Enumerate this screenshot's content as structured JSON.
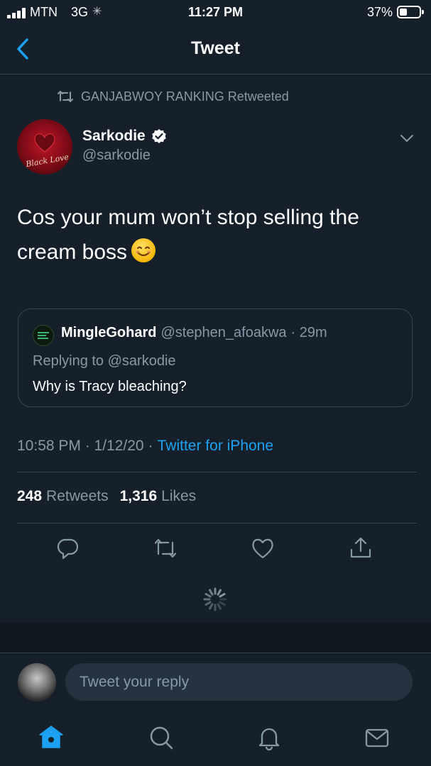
{
  "status_bar": {
    "carrier": "MTN",
    "network": "3G",
    "time": "11:27 PM",
    "battery_percent": "37%",
    "battery_level": 0.37
  },
  "header": {
    "title": "Tweet",
    "back_icon": "chevron-left-icon"
  },
  "retweet_context": {
    "text": "GANJABWOY RANKING Retweeted",
    "icon": "retweet-icon"
  },
  "tweet": {
    "author_name": "Sarkodie",
    "verified": true,
    "author_handle": "@sarkodie",
    "avatar_caption": "Black Love",
    "text": "Cos your mum won’t stop selling the cream boss",
    "emoji": "smiling-face-emoji",
    "timestamp": "10:58 PM · 1/12/20",
    "separator": "·",
    "source": "Twitter for iPhone",
    "retweets_count": "248",
    "retweets_label": "Retweets",
    "likes_count": "1,316",
    "likes_label": "Likes"
  },
  "quoted_tweet": {
    "author_name": "MingleGohard",
    "author_handle": "@stephen_afoakwa",
    "age": "· 29m",
    "replying_to": "Replying to @sarkodie",
    "text": "Why is Tracy bleaching?"
  },
  "actions": [
    "reply-icon",
    "retweet-icon",
    "like-icon",
    "share-icon"
  ],
  "reply_box": {
    "placeholder": "Tweet your reply"
  },
  "tab_bar": [
    "home-icon",
    "search-icon",
    "notifications-icon",
    "messages-icon"
  ],
  "colors": {
    "background": "#15202b",
    "accent": "#1da1f2",
    "muted": "#8899a6",
    "divider": "#38444d"
  }
}
